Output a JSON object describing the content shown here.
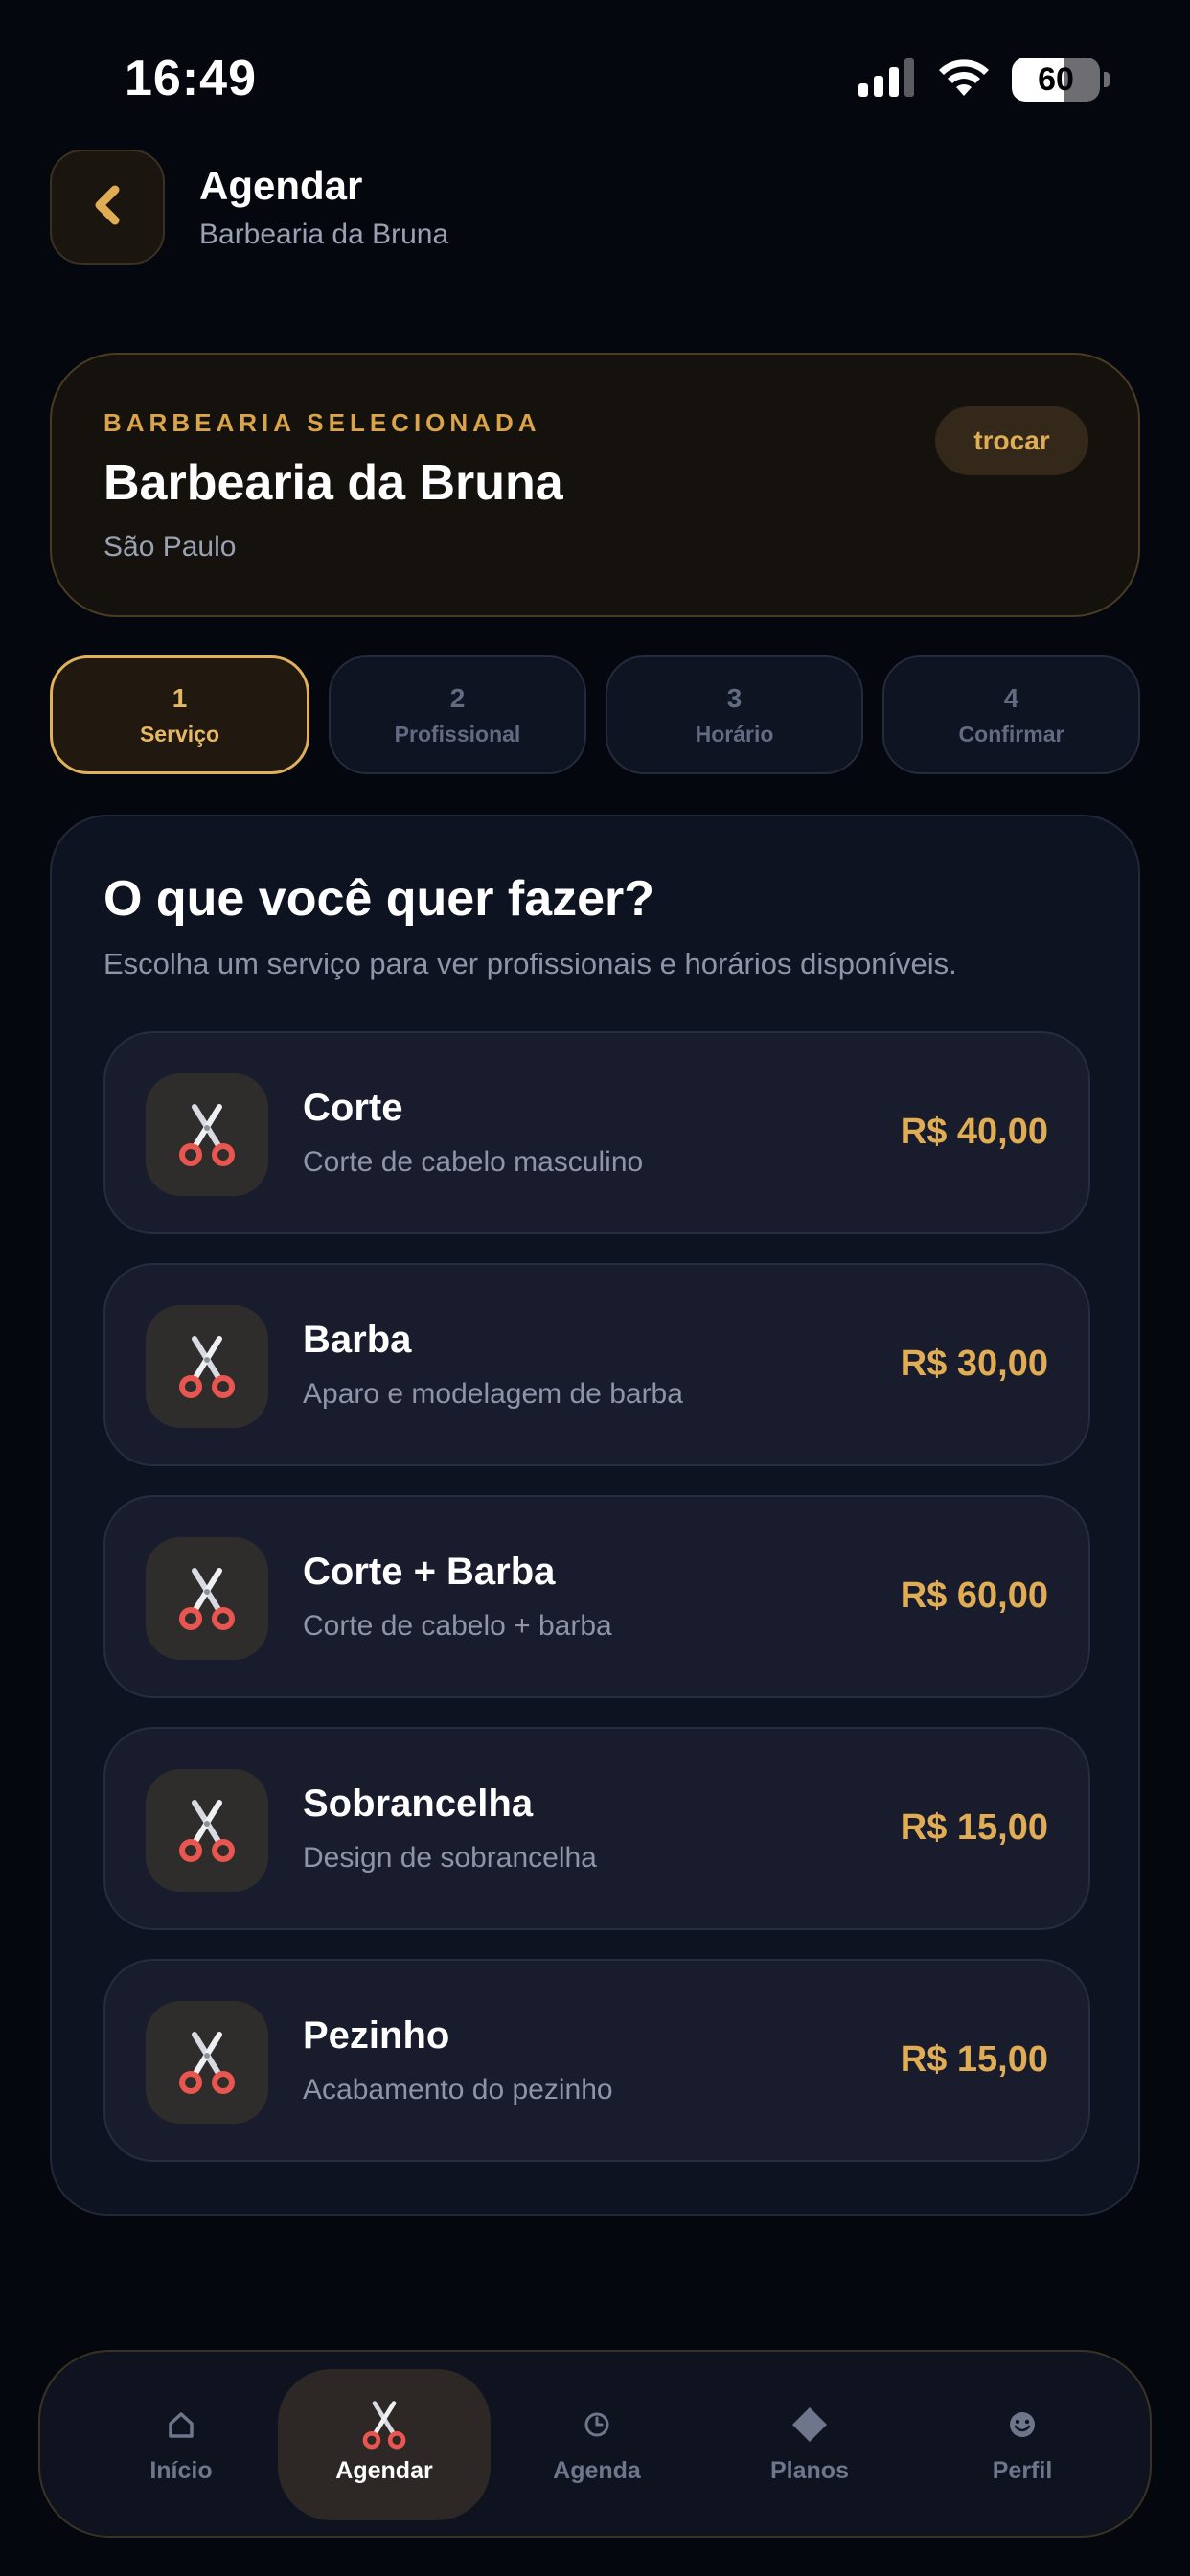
{
  "status_bar": {
    "time": "16:49",
    "battery_level": "60",
    "battery_fraction": 0.6
  },
  "header": {
    "back_icon": "chevron-left-icon",
    "title": "Agendar",
    "subtitle": "Barbearia da Bruna"
  },
  "selected_shop": {
    "eyebrow": "BARBEARIA SELECIONADA",
    "name": "Barbearia da Bruna",
    "city": "São Paulo",
    "change_label": "trocar"
  },
  "steps": [
    {
      "number": "1",
      "label": "Serviço",
      "active": true
    },
    {
      "number": "2",
      "label": "Profissional",
      "active": false
    },
    {
      "number": "3",
      "label": "Horário",
      "active": false
    },
    {
      "number": "4",
      "label": "Confirmar",
      "active": false
    }
  ],
  "panel": {
    "title": "O que você quer fazer?",
    "subtitle": "Escolha um serviço para ver profissionais e horários disponíveis."
  },
  "services": [
    {
      "name": "Corte",
      "description": "Corte de cabelo masculino",
      "price": "R$ 40,00",
      "icon": "scissors-icon"
    },
    {
      "name": "Barba",
      "description": "Aparo e modelagem de barba",
      "price": "R$ 30,00",
      "icon": "scissors-icon"
    },
    {
      "name": "Corte + Barba",
      "description": "Corte de cabelo + barba",
      "price": "R$ 60,00",
      "icon": "scissors-icon"
    },
    {
      "name": "Sobrancelha",
      "description": "Design de sobrancelha",
      "price": "R$ 15,00",
      "icon": "scissors-icon"
    },
    {
      "name": "Pezinho",
      "description": "Acabamento do pezinho",
      "price": "R$ 15,00",
      "icon": "scissors-icon"
    }
  ],
  "bottom_nav": [
    {
      "label": "Início",
      "icon": "home-icon",
      "active": false
    },
    {
      "label": "Agendar",
      "icon": "scissors-icon",
      "active": true
    },
    {
      "label": "Agenda",
      "icon": "clock-icon",
      "active": false
    },
    {
      "label": "Planos",
      "icon": "diamond-icon",
      "active": false
    },
    {
      "label": "Perfil",
      "icon": "smiley-icon",
      "active": false
    }
  ],
  "colors": {
    "background": "#05070e",
    "accent": "#e0ad55",
    "card": "#181c2d",
    "muted_text": "#8e95a8"
  }
}
